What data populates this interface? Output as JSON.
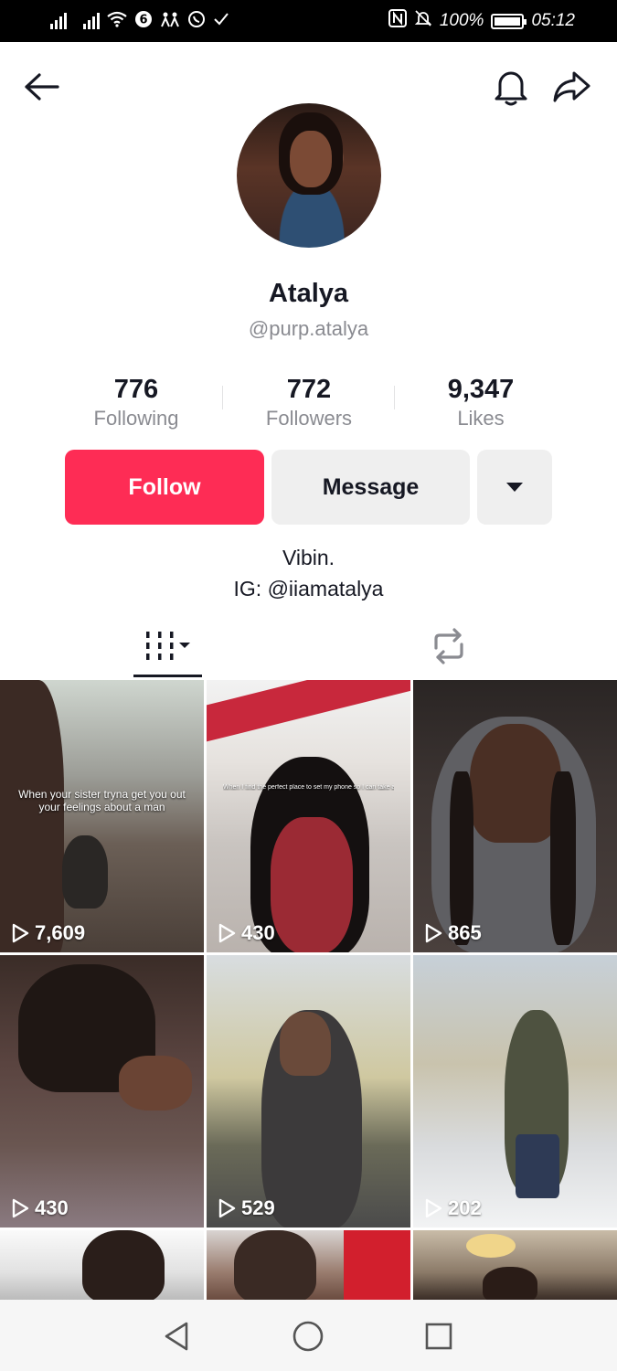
{
  "status_bar": {
    "battery": "100%",
    "time": "05:12"
  },
  "profile": {
    "name": "Atalya",
    "handle": "@purp.atalya"
  },
  "stats": [
    {
      "value": "776",
      "label": "Following"
    },
    {
      "value": "772",
      "label": "Followers"
    },
    {
      "value": "9,347",
      "label": "Likes"
    }
  ],
  "actions": {
    "follow_label": "Follow",
    "message_label": "Message"
  },
  "bio": {
    "line1": "Vibin.",
    "line2": "IG: @iiamatalya"
  },
  "videos": [
    {
      "views": "7,609",
      "caption": "When your sister tryna get you out your feelings about a man"
    },
    {
      "views": "430",
      "caption": "When I find the perfect place to set my phone so I can take a video"
    },
    {
      "views": "865"
    },
    {
      "views": "430"
    },
    {
      "views": "529"
    },
    {
      "views": "202"
    }
  ],
  "colors": {
    "accent": "#fe2c55",
    "text": "#161823",
    "muted": "#8a8b91",
    "button_bg": "#efefef"
  }
}
